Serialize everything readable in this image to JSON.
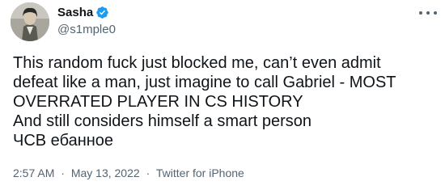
{
  "author": {
    "display_name": "Sasha",
    "handle": "@s1mple0",
    "verified_icon": "verified-badge-icon",
    "avatar_icon": "avatar-photo"
  },
  "more_menu_icon": "more-horizontal-icon",
  "tweet": {
    "lines": [
      "This random fuck just blocked me, can’t even admit",
      "defeat like a man, just imagine to call Gabriel - MOST",
      "OVERRATED PLAYER IN CS HISTORY",
      "And still considers himself a smart person",
      "ЧСВ ебанное"
    ]
  },
  "meta": {
    "time": "2:57 AM",
    "separator": "·",
    "date": "May 13, 2022",
    "source": "Twitter for iPhone"
  },
  "colors": {
    "text": "#0f1419",
    "secondary": "#536471",
    "verified": "#1d9bf0"
  }
}
